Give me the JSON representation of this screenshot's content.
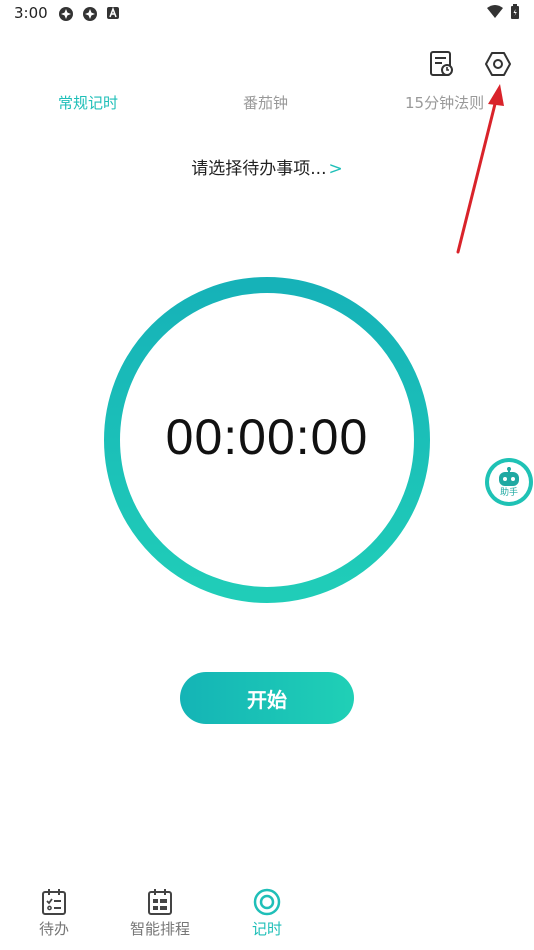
{
  "status_bar": {
    "time": "3:00"
  },
  "tabs": [
    {
      "label": "常规记时",
      "active": true
    },
    {
      "label": "番茄钟",
      "active": false
    },
    {
      "label": "15分钟法则",
      "active": false
    }
  ],
  "todo_select": {
    "label": "请选择待办事项...",
    "chevron": ">"
  },
  "timer": {
    "display": "00:00:00",
    "progress": 1.0
  },
  "start_button": {
    "label": "开始"
  },
  "assistant": {
    "label": "助手"
  },
  "bottom_nav": [
    {
      "label": "待办",
      "icon": "todo-list-icon",
      "active": false
    },
    {
      "label": "智能排程",
      "icon": "schedule-grid-icon",
      "active": false
    },
    {
      "label": "记时",
      "icon": "timer-icon",
      "active": true
    }
  ],
  "colors": {
    "accent": "#1fbfb8",
    "annotation_arrow": "#d9232a"
  }
}
